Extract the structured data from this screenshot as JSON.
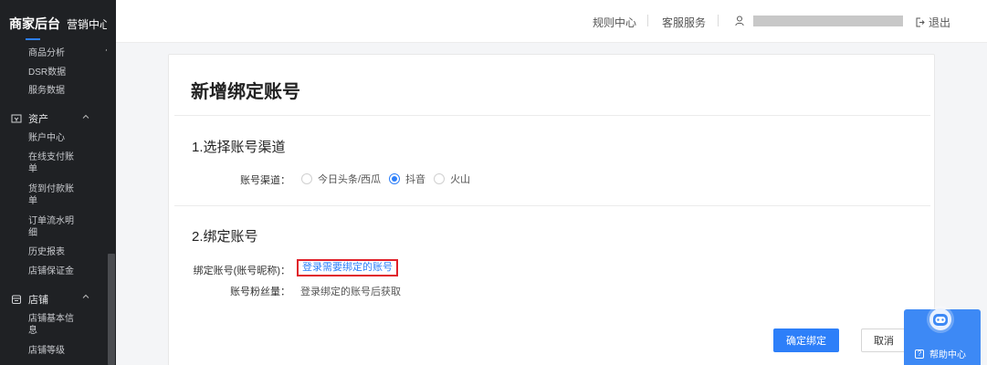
{
  "sidebar": {
    "brand_title": "商家后台",
    "brand_subtitle": "营销中心",
    "data_items": [
      "商品分析",
      "DSR数据",
      "服务数据"
    ],
    "assets_group": "资产",
    "assets_items": [
      "账户中心",
      "在线支付账单",
      "货到付款账单",
      "订单流水明细",
      "历史报表",
      "店铺保证金"
    ],
    "store_group": "店铺",
    "store_items": [
      "店铺基本信息",
      "店铺等级"
    ]
  },
  "header": {
    "rules_center": "规则中心",
    "customer_service": "客服服务",
    "logout": "退出"
  },
  "page": {
    "title": "新增绑定账号",
    "section1_title": "1.选择账号渠道",
    "channel_label": "账号渠道：",
    "channel_options": [
      "今日头条/西瓜",
      "抖音",
      "火山"
    ],
    "channel_selected": "抖音",
    "section2_title": "2.绑定账号",
    "bind_label": "绑定账号(账号昵称)：",
    "bind_link": "登录需要绑定的账号",
    "fans_label": "账号粉丝量：",
    "fans_value": "登录绑定的账号后获取",
    "confirm_button": "确定绑定",
    "cancel_button": "取消"
  },
  "help": {
    "label": "帮助中心"
  },
  "colors": {
    "accent": "#2d7ff9",
    "sidebar_bg": "#1f2124",
    "highlight_border": "#e0202a"
  }
}
